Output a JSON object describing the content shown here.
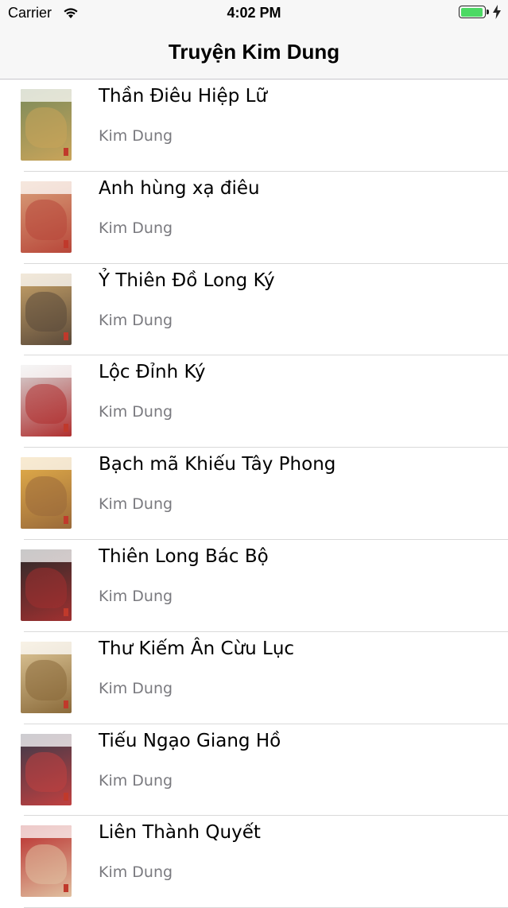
{
  "status_bar": {
    "carrier": "Carrier",
    "time": "4:02 PM",
    "battery_color": "#4cd964"
  },
  "nav": {
    "title": "Truyện Kim Dung"
  },
  "books": [
    {
      "title": "Thần Điêu Hiệp Lữ",
      "author": "Kim Dung",
      "cover_colors": [
        "#7a8a5a",
        "#c9a45a"
      ]
    },
    {
      "title": "Anh hùng xạ điêu",
      "author": "Kim Dung",
      "cover_colors": [
        "#d9a07a",
        "#b8473a"
      ]
    },
    {
      "title": "Ỷ Thiên Đồ Long Ký",
      "author": "Kim Dung",
      "cover_colors": [
        "#c9a46a",
        "#5b4a3a"
      ]
    },
    {
      "title": "Lộc Đỉnh Ký",
      "author": "Kim Dung",
      "cover_colors": [
        "#d7d7d7",
        "#b03030"
      ]
    },
    {
      "title": "Bạch mã Khiếu Tây Phong",
      "author": "Kim Dung",
      "cover_colors": [
        "#e6b04a",
        "#9a6a3a"
      ]
    },
    {
      "title": "Thiên Long Bác Bộ",
      "author": "Kim Dung",
      "cover_colors": [
        "#2a2a2a",
        "#a03030"
      ]
    },
    {
      "title": "Thư Kiếm Ân Cừu Lục",
      "author": "Kim Dung",
      "cover_colors": [
        "#e0c99a",
        "#8a6a3a"
      ]
    },
    {
      "title": "Tiếu Ngạo Giang Hồ",
      "author": "Kim Dung",
      "cover_colors": [
        "#3a3a4a",
        "#c04040"
      ]
    },
    {
      "title": "Liên Thành Quyết",
      "author": "Kim Dung",
      "cover_colors": [
        "#b82a2a",
        "#e0c0a0"
      ]
    }
  ]
}
